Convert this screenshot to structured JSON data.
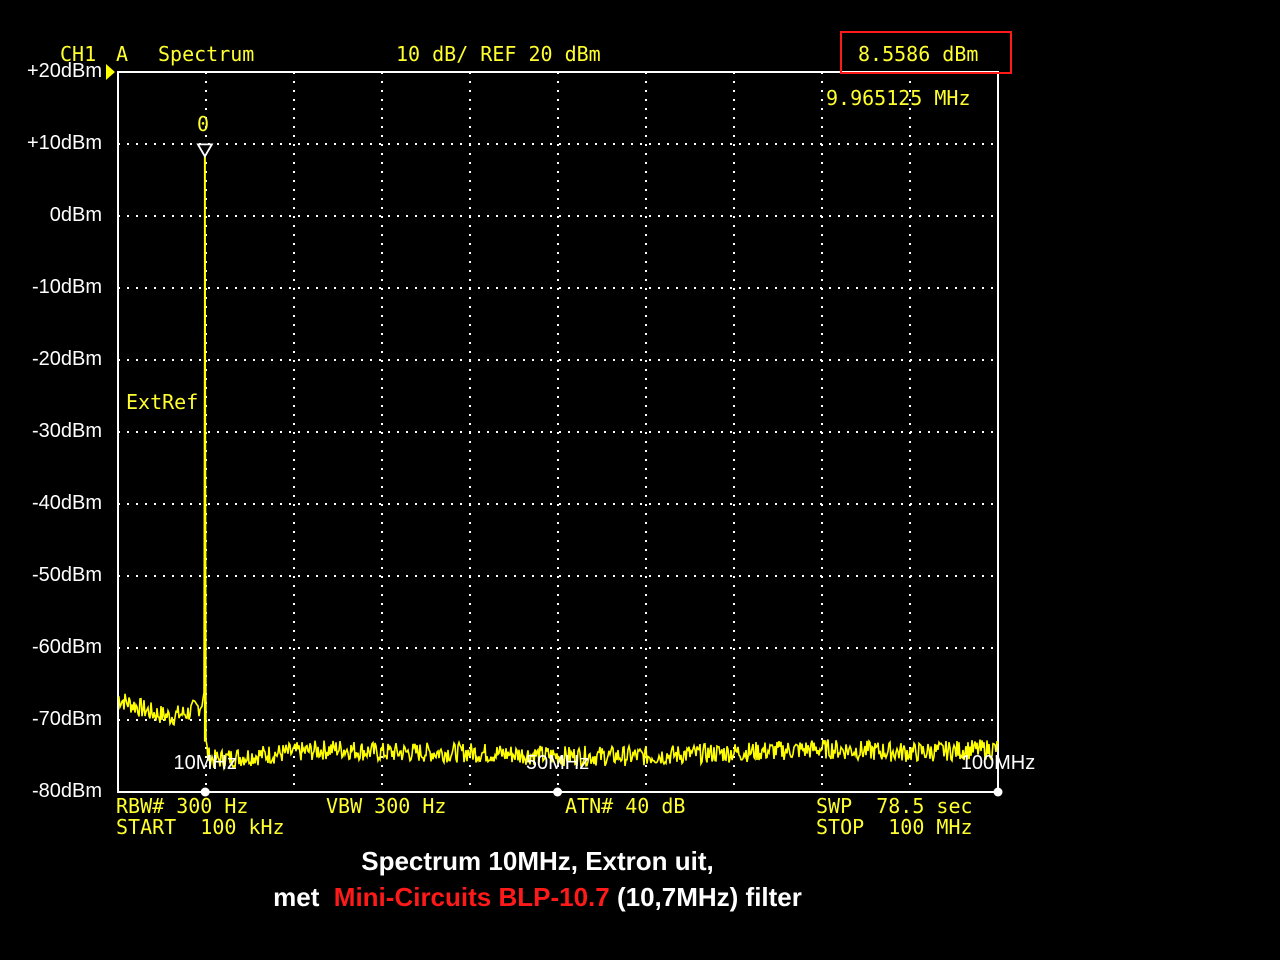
{
  "header": {
    "channel": "CH1",
    "trace": "A",
    "mode": "Spectrum",
    "scale": "10 dB/ REF 20 dBm",
    "marker_level": "8.5586 dBm",
    "marker_freq": "9.965125 MHz",
    "marker_label": "0",
    "ext_ref": "ExtRef"
  },
  "footer": {
    "rbw": "RBW# 300 Hz",
    "vbw": "VBW 300 Hz",
    "atn": "ATN# 40 dB",
    "swp": "SWP  78.5 sec",
    "start": "START  100 kHz",
    "stop": "STOP  100 MHz"
  },
  "caption": {
    "line1": "Spectrum 10MHz, Extron uit,",
    "line2_prefix": "met  ",
    "line2_red": "Mini-Circuits BLP-10.7",
    "line2_suffix": " (10,7MHz) filter"
  },
  "colors": {
    "trace": "#ffff00",
    "grid": "#ffffff",
    "highlight": "#ff1a1a"
  },
  "chart_data": {
    "type": "line",
    "xlabel": "",
    "ylabel": "",
    "xlim": [
      0.1,
      100
    ],
    "ylim": [
      -80,
      20
    ],
    "x_unit": "MHz",
    "y_unit": "dBm",
    "y_tick_values": [
      20,
      10,
      0,
      -10,
      -20,
      -30,
      -40,
      -50,
      -60,
      -70,
      -80
    ],
    "y_tick_labels": [
      "+20dBm",
      "+10dBm",
      "0dBm",
      "-10dBm",
      "-20dBm",
      "-30dBm",
      "-40dBm",
      "-50dBm",
      "-60dBm",
      "-70dBm",
      "-80dBm"
    ],
    "x_tick_values": [
      10,
      50,
      100
    ],
    "x_tick_labels": [
      "10MHz",
      "50MHz",
      "100MHz"
    ],
    "grid": true,
    "marker": {
      "x": 9.965125,
      "y": 8.5586
    },
    "series": [
      {
        "x": [
          0.1,
          2,
          4,
          6,
          8,
          9.5,
          9.9,
          9.965,
          10.05,
          10.3,
          11,
          15,
          20,
          25,
          30,
          40,
          50,
          60,
          70,
          80,
          90,
          100
        ],
        "y": [
          -67,
          -68,
          -69,
          -69.5,
          -69,
          -68,
          -66,
          8.6,
          -73,
          -75,
          -75.5,
          -75,
          -74.5,
          -74,
          -74.5,
          -74.5,
          -75,
          -75,
          -74.5,
          -74,
          -74.5,
          -74
        ]
      }
    ]
  }
}
